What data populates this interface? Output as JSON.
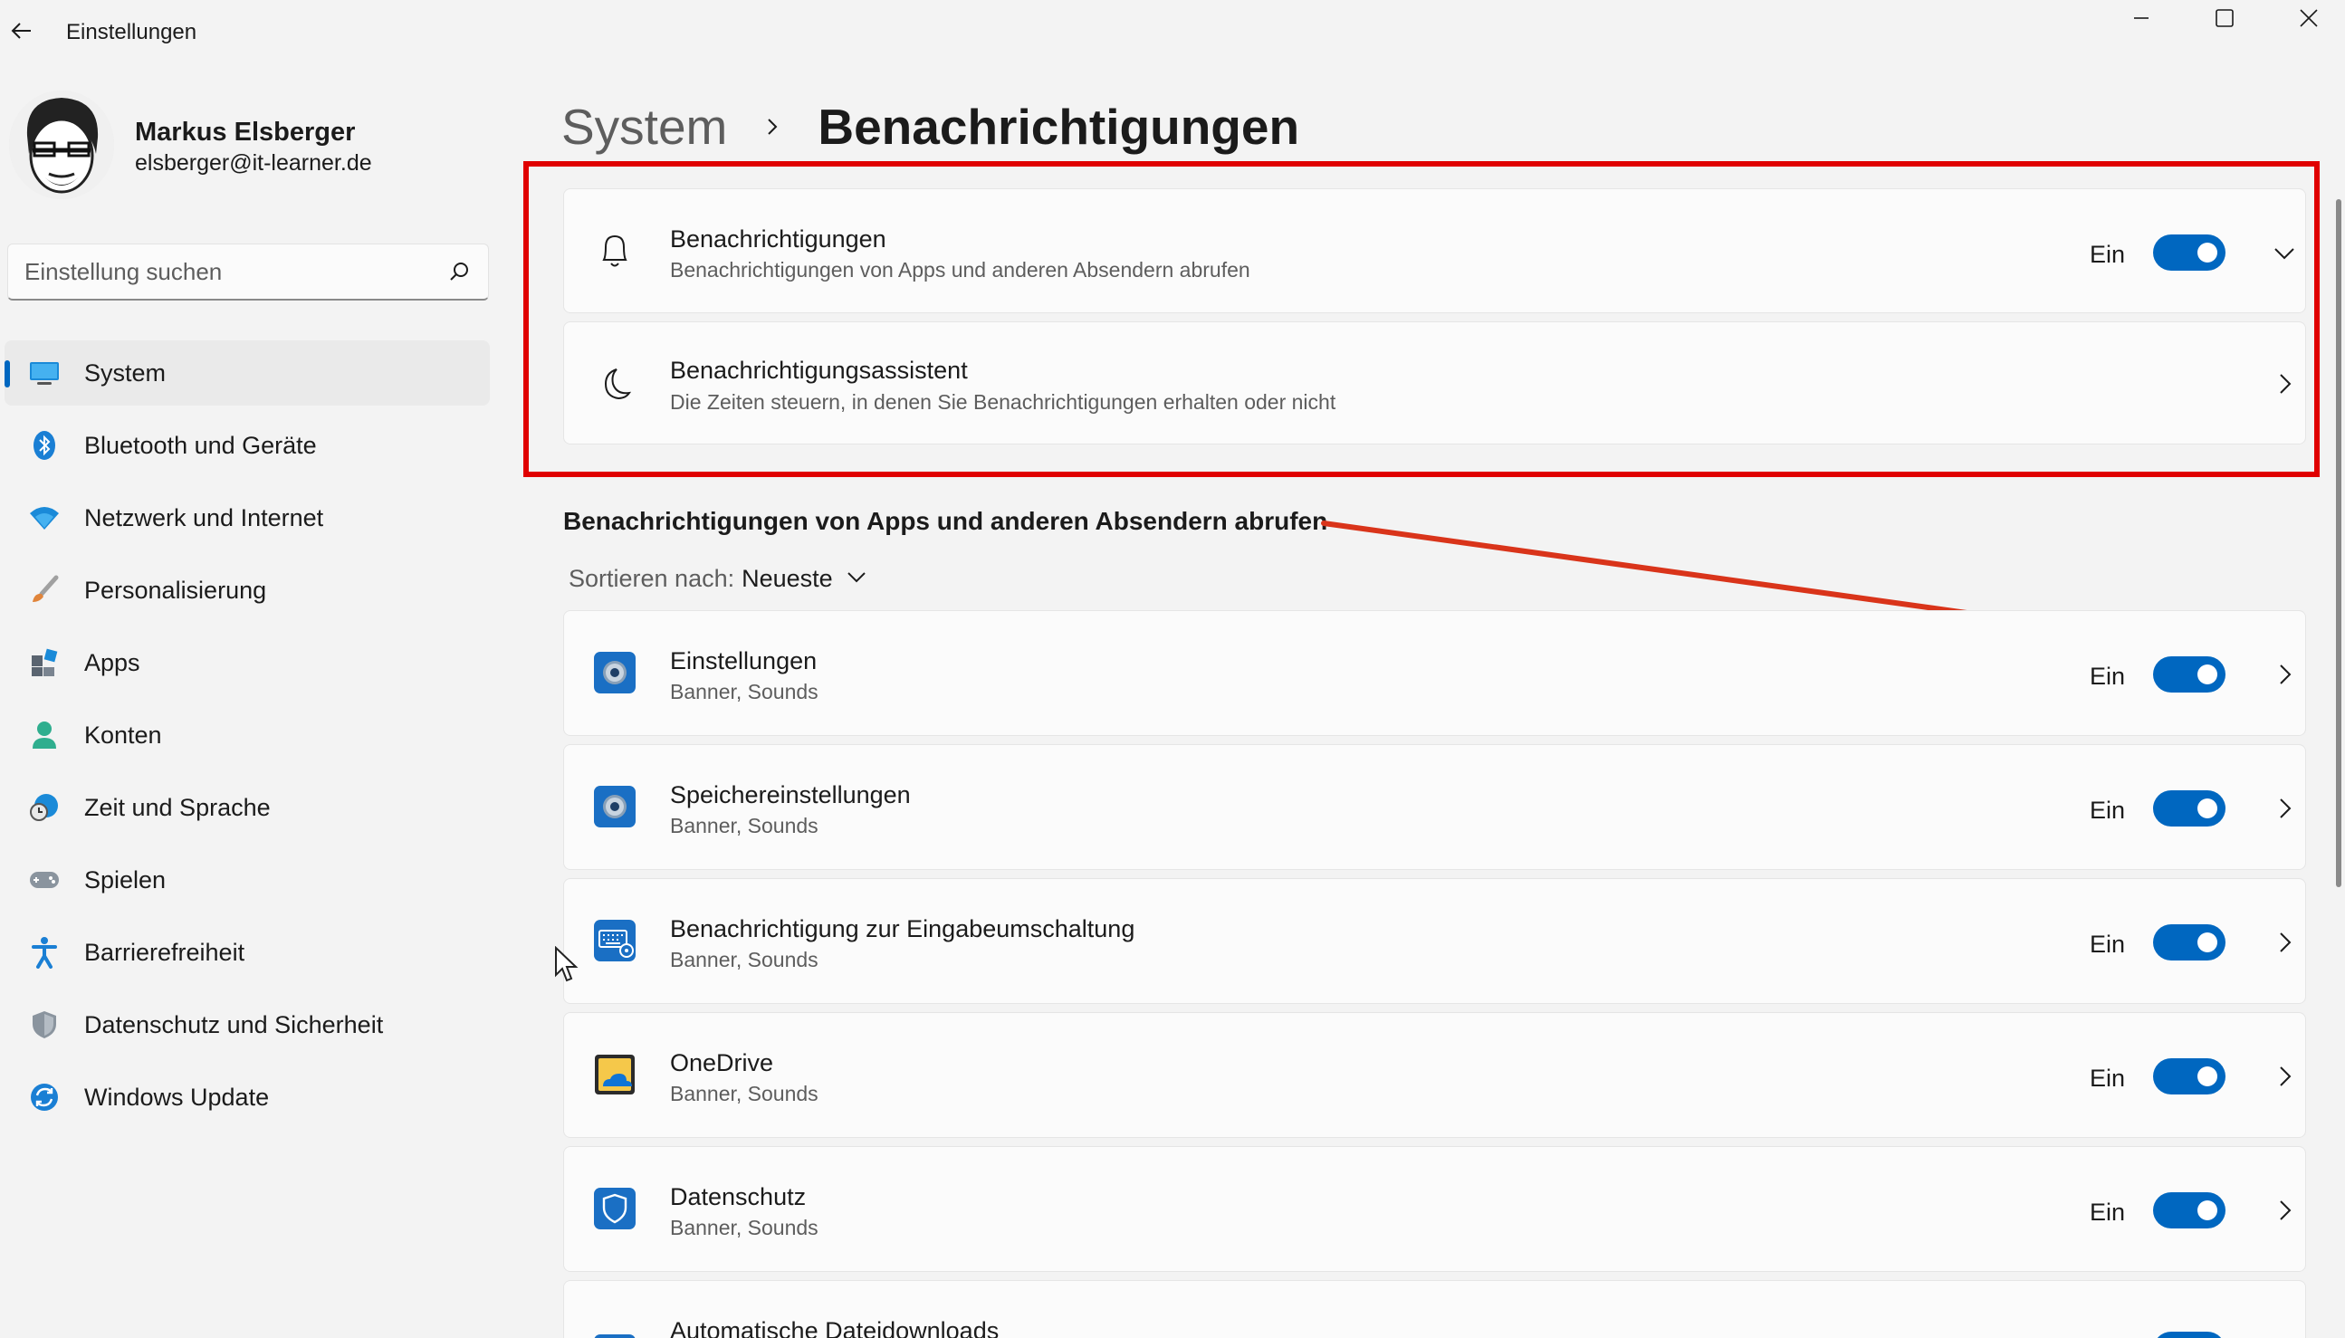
{
  "window": {
    "title": "Einstellungen"
  },
  "user": {
    "name": "Markus Elsberger",
    "email": "elsberger@it-learner.de"
  },
  "search": {
    "placeholder": "Einstellung suchen"
  },
  "nav": {
    "items": [
      {
        "label": "System",
        "icon": "monitor-icon",
        "active": true
      },
      {
        "label": "Bluetooth und Geräte",
        "icon": "bluetooth-icon"
      },
      {
        "label": "Netzwerk und Internet",
        "icon": "wifi-icon"
      },
      {
        "label": "Personalisierung",
        "icon": "brush-icon"
      },
      {
        "label": "Apps",
        "icon": "apps-icon"
      },
      {
        "label": "Konten",
        "icon": "person-icon"
      },
      {
        "label": "Zeit und Sprache",
        "icon": "clock-globe-icon"
      },
      {
        "label": "Spielen",
        "icon": "gamepad-icon"
      },
      {
        "label": "Barrierefreiheit",
        "icon": "accessibility-icon"
      },
      {
        "label": "Datenschutz und Sicherheit",
        "icon": "shield-icon"
      },
      {
        "label": "Windows Update",
        "icon": "update-icon"
      }
    ]
  },
  "breadcrumb": {
    "parent": "System",
    "current": "Benachrichtigungen"
  },
  "top_settings": [
    {
      "title": "Benachrichtigungen",
      "subtitle": "Benachrichtigungen von Apps und anderen Absendern abrufen",
      "state": "Ein",
      "icon": "bell-icon"
    },
    {
      "title": "Benachrichtigungsassistent",
      "subtitle": "Die Zeiten steuern, in denen Sie Benachrichtigungen erhalten oder nicht",
      "icon": "moon-icon"
    }
  ],
  "apps_section": {
    "title": "Benachrichtigungen von Apps und anderen Absendern abrufen",
    "sort_label": "Sortieren nach:",
    "sort_value": "Neueste"
  },
  "apps": [
    {
      "name": "Einstellungen",
      "detail": "Banner, Sounds",
      "state": "Ein",
      "icon": "settings-gear-icon"
    },
    {
      "name": "Speichereinstellungen",
      "detail": "Banner, Sounds",
      "state": "Ein",
      "icon": "storage-settings-icon"
    },
    {
      "name": "Benachrichtigung zur Eingabeumschaltung",
      "detail": "Banner, Sounds",
      "state": "Ein",
      "icon": "keyboard-settings-icon"
    },
    {
      "name": "OneDrive",
      "detail": "Banner, Sounds",
      "state": "Ein",
      "icon": "onedrive-icon"
    },
    {
      "name": "Datenschutz",
      "detail": "Banner, Sounds",
      "state": "Ein",
      "icon": "privacy-shield-icon"
    },
    {
      "name": "Automatische Dateidownloads",
      "icon": "download-icon"
    }
  ],
  "colors": {
    "accent": "#0067c0",
    "highlight": "#e00000",
    "annotation_arrow": "#d9341a"
  }
}
